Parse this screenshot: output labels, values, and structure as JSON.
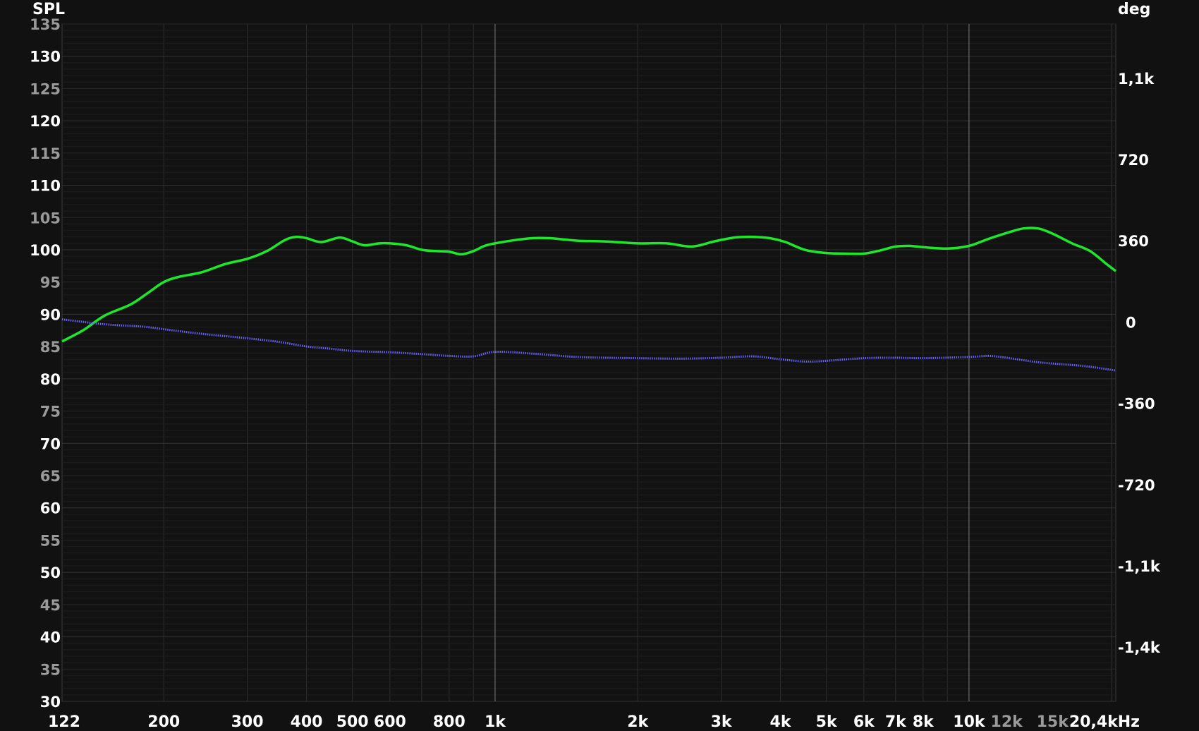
{
  "chart_data": {
    "type": "line",
    "x_scale": "log",
    "grid": true,
    "colors": {
      "background": "#111111",
      "plot_background": "#121212",
      "spl_series": "#1ee62a",
      "phase_series": "#6a62ff",
      "label_bright": "#ffffff",
      "label_dim": "#9a9a9a"
    },
    "left_axis": {
      "label": "SPL",
      "range": [
        30,
        135
      ],
      "ticks": [
        {
          "value": 135,
          "text": "135",
          "dim": true
        },
        {
          "value": 130,
          "text": "130",
          "dim": false
        },
        {
          "value": 125,
          "text": "125",
          "dim": true
        },
        {
          "value": 120,
          "text": "120",
          "dim": false
        },
        {
          "value": 115,
          "text": "115",
          "dim": true
        },
        {
          "value": 110,
          "text": "110",
          "dim": false
        },
        {
          "value": 105,
          "text": "105",
          "dim": true
        },
        {
          "value": 100,
          "text": "100",
          "dim": false
        },
        {
          "value": 95,
          "text": "95",
          "dim": true
        },
        {
          "value": 90,
          "text": "90",
          "dim": false
        },
        {
          "value": 85,
          "text": "85",
          "dim": true
        },
        {
          "value": 80,
          "text": "80",
          "dim": false
        },
        {
          "value": 75,
          "text": "75",
          "dim": true
        },
        {
          "value": 70,
          "text": "70",
          "dim": false
        },
        {
          "value": 65,
          "text": "65",
          "dim": true
        },
        {
          "value": 60,
          "text": "60",
          "dim": false
        },
        {
          "value": 55,
          "text": "55",
          "dim": true
        },
        {
          "value": 50,
          "text": "50",
          "dim": false
        },
        {
          "value": 45,
          "text": "45",
          "dim": true
        },
        {
          "value": 40,
          "text": "40",
          "dim": false
        },
        {
          "value": 35,
          "text": "35",
          "dim": true
        },
        {
          "value": 30,
          "text": "30",
          "dim": false
        }
      ]
    },
    "right_axis": {
      "label": "deg",
      "range": [
        -1680,
        1320
      ],
      "ticks": [
        {
          "value": 1080,
          "text": "1,1k"
        },
        {
          "value": 720,
          "text": "720"
        },
        {
          "value": 360,
          "text": "360"
        },
        {
          "value": 0,
          "text": "0"
        },
        {
          "value": -360,
          "text": "-360"
        },
        {
          "value": -720,
          "text": "-720"
        },
        {
          "value": -1080,
          "text": "-1,1k"
        },
        {
          "value": -1440,
          "text": "-1,4k"
        }
      ]
    },
    "x_axis": {
      "range": [
        122,
        20400
      ],
      "ticks": [
        {
          "value": 122,
          "text": "122",
          "dim": false
        },
        {
          "value": 200,
          "text": "200",
          "dim": false
        },
        {
          "value": 300,
          "text": "300",
          "dim": false
        },
        {
          "value": 400,
          "text": "400",
          "dim": false
        },
        {
          "value": 500,
          "text": "500",
          "dim": false
        },
        {
          "value": 600,
          "text": "600",
          "dim": false
        },
        {
          "value": 800,
          "text": "800",
          "dim": false
        },
        {
          "value": 1000,
          "text": "1k",
          "dim": false
        },
        {
          "value": 2000,
          "text": "2k",
          "dim": false
        },
        {
          "value": 3000,
          "text": "3k",
          "dim": false
        },
        {
          "value": 4000,
          "text": "4k",
          "dim": false
        },
        {
          "value": 5000,
          "text": "5k",
          "dim": false
        },
        {
          "value": 6000,
          "text": "6k",
          "dim": false
        },
        {
          "value": 7000,
          "text": "7k",
          "dim": false
        },
        {
          "value": 8000,
          "text": "8k",
          "dim": false
        },
        {
          "value": 10000,
          "text": "10k",
          "dim": false
        },
        {
          "value": 12000,
          "text": "12k",
          "dim": true
        },
        {
          "value": 15000,
          "text": "15k",
          "dim": true
        },
        {
          "value": 20400,
          "text": "20,4kHz",
          "dim": false
        }
      ],
      "major_gridlines": [
        1000,
        10000
      ]
    },
    "series": [
      {
        "axis": "left",
        "style": "solid",
        "x": [
          122,
          135,
          150,
          170,
          185,
          200,
          215,
          240,
          270,
          300,
          330,
          360,
          380,
          400,
          430,
          470,
          500,
          530,
          570,
          600,
          650,
          700,
          750,
          800,
          850,
          900,
          950,
          1000,
          1100,
          1200,
          1300,
          1400,
          1500,
          1700,
          2000,
          2300,
          2600,
          2900,
          3200,
          3500,
          3800,
          4100,
          4500,
          5000,
          5500,
          6000,
          6500,
          7000,
          7500,
          8000,
          9000,
          10000,
          11000,
          12000,
          13000,
          14000,
          15000,
          16500,
          18000,
          19500,
          20400
        ],
        "y": [
          85.8,
          87.5,
          89.8,
          91.5,
          93.3,
          95.0,
          95.8,
          96.5,
          97.8,
          98.6,
          99.8,
          101.5,
          102.0,
          101.8,
          101.2,
          101.9,
          101.3,
          100.7,
          101.0,
          101.0,
          100.7,
          100.0,
          99.8,
          99.7,
          99.3,
          99.8,
          100.6,
          101.0,
          101.5,
          101.8,
          101.8,
          101.6,
          101.4,
          101.3,
          101.0,
          101.0,
          100.5,
          101.3,
          101.9,
          102.0,
          101.8,
          101.2,
          100.0,
          99.5,
          99.4,
          99.4,
          99.9,
          100.5,
          100.6,
          100.4,
          100.2,
          100.6,
          101.7,
          102.6,
          103.3,
          103.3,
          102.5,
          101.0,
          99.8,
          97.8,
          96.7
        ]
      },
      {
        "axis": "right",
        "style": "dotted",
        "x": [
          122,
          150,
          180,
          200,
          240,
          300,
          350,
          400,
          450,
          500,
          600,
          700,
          800,
          900,
          1000,
          1200,
          1500,
          2000,
          2500,
          3000,
          3500,
          4000,
          4500,
          5000,
          6000,
          7000,
          8000,
          10000,
          11000,
          12000,
          14000,
          16000,
          18000,
          20400
        ],
        "y": [
          12,
          -10,
          -20,
          -32,
          -52,
          -72,
          -88,
          -108,
          -118,
          -128,
          -134,
          -142,
          -150,
          -152,
          -132,
          -140,
          -155,
          -160,
          -162,
          -158,
          -152,
          -165,
          -175,
          -172,
          -160,
          -158,
          -160,
          -155,
          -150,
          -158,
          -178,
          -188,
          -198,
          -215
        ]
      }
    ]
  }
}
